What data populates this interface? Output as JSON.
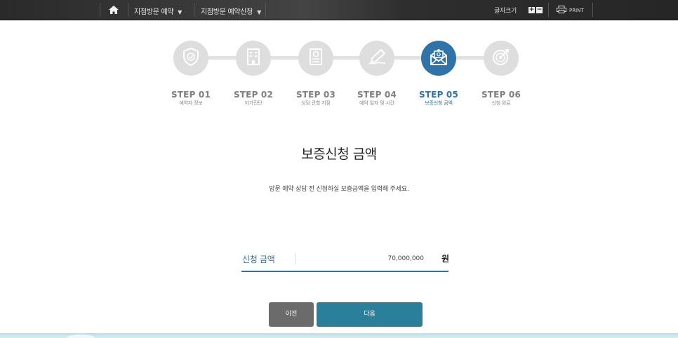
{
  "topbar": {
    "nav": [
      {
        "label": "지점방문 예약",
        "caret": "▼"
      },
      {
        "label": "지점방문 예약신청",
        "caret": "▼"
      }
    ],
    "font_size_label": "글자크기",
    "font_plus": "+",
    "font_minus": "−",
    "print_label": "PRINT"
  },
  "steps": [
    {
      "title": "STEP 01",
      "sub": "예약자 정보",
      "icon": "shield-check-icon",
      "active": false
    },
    {
      "title": "STEP 02",
      "sub": "자가진단",
      "icon": "building-icon",
      "active": false
    },
    {
      "title": "STEP 03",
      "sub": "상담 관할 지점",
      "icon": "document-search-icon",
      "active": false
    },
    {
      "title": "STEP 04",
      "sub": "예약 일자 및 시간",
      "icon": "pen-sign-icon",
      "active": false
    },
    {
      "title": "STEP 05",
      "sub": "보증신청 금액",
      "icon": "envelope-money-icon",
      "active": true
    },
    {
      "title": "STEP 06",
      "sub": "신청 완료",
      "icon": "target-icon",
      "active": false
    }
  ],
  "main": {
    "title": "보증신청 금액",
    "description": "방문 예약 상담 전 신청하실 보증금액을 입력해 주세요.",
    "amount_label": "신청 금액",
    "amount_value": "70,000,000",
    "amount_unit": "원"
  },
  "buttons": {
    "prev": "이전",
    "next": "다음"
  },
  "colors": {
    "accent": "#2f73a8",
    "next_button": "#2a7f9a",
    "prev_button": "#6b6b6b",
    "inactive_step": "#dedede"
  }
}
